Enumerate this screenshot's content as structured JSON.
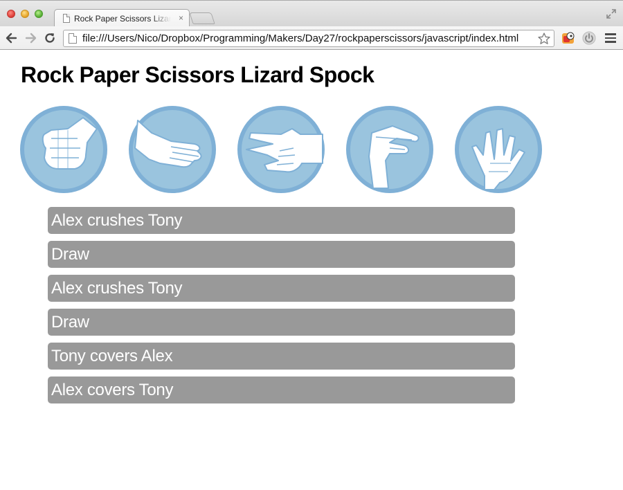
{
  "browser": {
    "tab_title": "Rock Paper Scissors Lizard Spock",
    "tab_close": "×",
    "url": "file:///Users/Nico/Dropbox/Programming/Makers/Day27/rockpaperscissors/javascript/index.html"
  },
  "page": {
    "title": "Rock Paper Scissors Lizard Spock"
  },
  "choices": [
    {
      "name": "rock",
      "icon": "rock-hand-icon"
    },
    {
      "name": "paper",
      "icon": "paper-hand-icon"
    },
    {
      "name": "scissors",
      "icon": "scissors-hand-icon"
    },
    {
      "name": "lizard",
      "icon": "lizard-hand-icon"
    },
    {
      "name": "spock",
      "icon": "spock-hand-icon"
    }
  ],
  "results": [
    "Alex crushes Tony",
    "Draw",
    "Alex crushes Tony",
    "Draw",
    "Tony covers Alex",
    "Alex covers Tony"
  ],
  "colors": {
    "circle_fill": "#9ac4de",
    "circle_ring": "#7fb0d6",
    "result_bg": "#999999",
    "result_text": "#ffffff"
  }
}
